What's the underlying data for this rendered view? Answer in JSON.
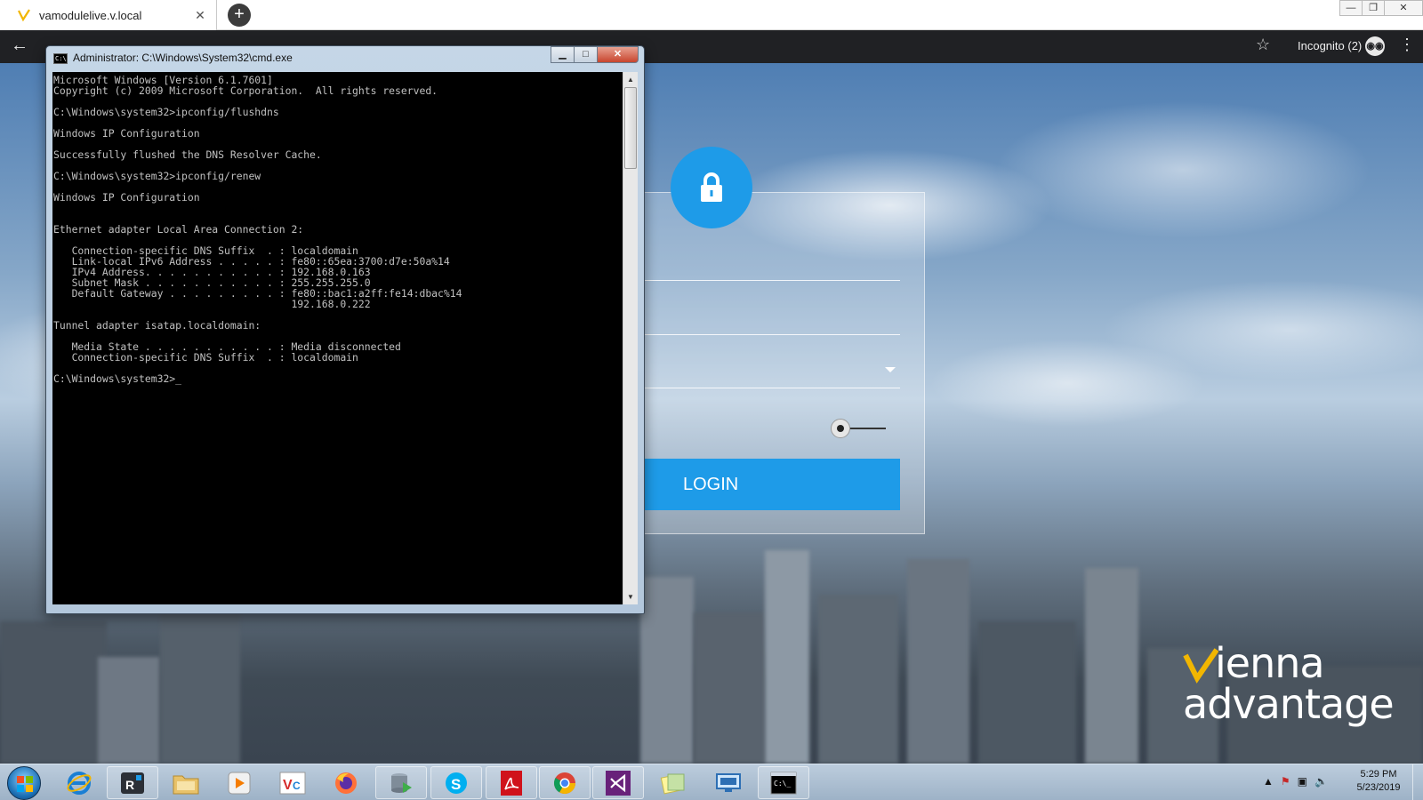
{
  "browser": {
    "tab_title": "vamodulelive.v.local",
    "tab_close": "✕",
    "new_tab": "+",
    "incognito_label": "Incognito (2)",
    "window_controls": {
      "minimize": "—",
      "restore": "❐",
      "close": "✕"
    }
  },
  "cmd": {
    "title": "Administrator: C:\\Windows\\System32\\cmd.exe",
    "output": "Microsoft Windows [Version 6.1.7601]\nCopyright (c) 2009 Microsoft Corporation.  All rights reserved.\n\nC:\\Windows\\system32>ipconfig/flushdns\n\nWindows IP Configuration\n\nSuccessfully flushed the DNS Resolver Cache.\n\nC:\\Windows\\system32>ipconfig/renew\n\nWindows IP Configuration\n\n\nEthernet adapter Local Area Connection 2:\n\n   Connection-specific DNS Suffix  . : localdomain\n   Link-local IPv6 Address . . . . . : fe80::65ea:3700:d7e:50a%14\n   IPv4 Address. . . . . . . . . . . : 192.168.0.163\n   Subnet Mask . . . . . . . . . . . : 255.255.255.0\n   Default Gateway . . . . . . . . . : fe80::bac1:a2ff:fe14:dbac%14\n                                       192.168.0.222\n\nTunnel adapter isatap.localdomain:\n\n   Media State . . . . . . . . . . . : Media disconnected\n   Connection-specific DNS Suffix  . : localdomain\n\nC:\\Windows\\system32>_",
    "buttons": {
      "minimize": "▁",
      "maximize": "□",
      "close": "✕"
    },
    "scroll_up": "▲",
    "scroll_down": "▼"
  },
  "login": {
    "button_label": "LOGIN"
  },
  "brand": {
    "line1": "ienna",
    "line2": "advantage"
  },
  "taskbar": {
    "apps": [
      "internet-explorer",
      "remote-app",
      "file-explorer",
      "media-player",
      "vc-app",
      "firefox",
      "database-tool",
      "skype",
      "acrobat",
      "chrome",
      "visual-studio",
      "notes",
      "remote-desktop",
      "cmd"
    ],
    "tray_icons": [
      "show-hidden-icons",
      "network-error",
      "action-center",
      "volume"
    ],
    "clock_time": "5:29 PM",
    "clock_date": "5/23/2019"
  },
  "colors": {
    "accent_blue": "#1e9be8",
    "chrome_toolbar": "#202124",
    "cmd_background": "#000000",
    "cmd_text": "#c0c0c0"
  }
}
